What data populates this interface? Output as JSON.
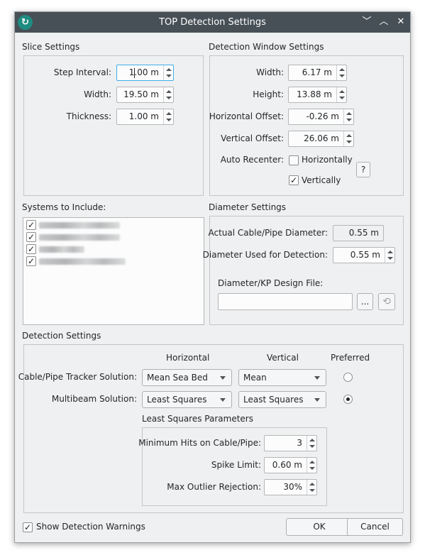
{
  "window": {
    "title": "TOP Detection Settings",
    "buttons": {
      "minimize": "﹀",
      "maximize": "︿",
      "close": "✕"
    }
  },
  "slice": {
    "title": "Slice Settings",
    "step_interval": {
      "label": "Step Interval:",
      "value": "1.00 m"
    },
    "width": {
      "label": "Width:",
      "value": "19.50 m"
    },
    "thickness": {
      "label": "Thickness:",
      "value": "1.00 m"
    }
  },
  "detection_window": {
    "title": "Detection Window Settings",
    "width": {
      "label": "Width:",
      "value": "6.17 m"
    },
    "height": {
      "label": "Height:",
      "value": "13.88 m"
    },
    "h_offset": {
      "label": "Horizontal Offset:",
      "value": "-0.26 m"
    },
    "v_offset": {
      "label": "Vertical Offset:",
      "value": "26.06 m"
    },
    "auto_recenter": {
      "label": "Auto Recenter:",
      "horizontally": {
        "label": "Horizontally",
        "checked": false
      },
      "vertically": {
        "label": "Vertically",
        "checked": true
      },
      "help": "?"
    }
  },
  "systems": {
    "title": "Systems to Include:",
    "items": [
      {
        "checked": true
      },
      {
        "checked": true
      },
      {
        "checked": true
      },
      {
        "checked": true
      }
    ]
  },
  "diameter": {
    "title": "Diameter Settings",
    "actual": {
      "label": "Actual Cable/Pipe Diameter:",
      "value": "0.55 m"
    },
    "used": {
      "label": "Diameter Used for Detection:",
      "value": "0.55 m"
    },
    "design_file": {
      "label": "Diameter/KP Design File:",
      "value": "",
      "browse": "..."
    }
  },
  "detection": {
    "title": "Detection Settings",
    "headers": {
      "horizontal": "Horizontal",
      "vertical": "Vertical",
      "preferred": "Preferred"
    },
    "tracker": {
      "label": "Cable/Pipe Tracker Solution:",
      "horizontal": "Mean Sea Bed",
      "vertical": "Mean",
      "preferred": false
    },
    "multibeam": {
      "label": "Multibeam Solution:",
      "horizontal": "Least Squares",
      "vertical": "Least Squares",
      "preferred": true
    },
    "least_squares": {
      "title": "Least Squares Parameters",
      "min_hits": {
        "label": "Minimum Hits on Cable/Pipe:",
        "value": "3"
      },
      "spike_limit": {
        "label": "Spike Limit:",
        "value": "0.60 m"
      },
      "outlier": {
        "label": "Max Outlier Rejection:",
        "value": "30%"
      }
    }
  },
  "footer": {
    "show_warnings": {
      "label": "Show Detection Warnings",
      "checked": true
    },
    "ok": "OK",
    "cancel": "Cancel"
  }
}
